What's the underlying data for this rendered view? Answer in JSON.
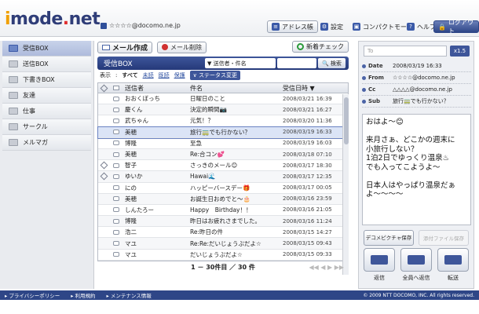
{
  "header": {
    "logo_main": "mode",
    "logo_i": "i",
    "logo_dot": ".",
    "logo_net": "net",
    "account": "☆☆☆☆@docomo.ne.jp",
    "buttons": [
      "アドレス帳",
      "設定",
      "コンパクトモード",
      "ヘルプ",
      "ログアウト"
    ]
  },
  "sidebar": {
    "items": [
      "受信BOX",
      "送信BOX",
      "下書きBOX",
      "友達",
      "仕事",
      "サークル",
      "メルマガ"
    ]
  },
  "toolbar": {
    "compose": "メール作成",
    "delete": "メール削除",
    "new_check": "新着チェック"
  },
  "box": {
    "title": "受信BOX",
    "search_select": "送信者・件名",
    "search_button": "検索"
  },
  "filter": {
    "label": "表示",
    "all": "すべて",
    "unread": "未読",
    "read": "既読",
    "protected": "保護",
    "status": "ステータス変更"
  },
  "table": {
    "headers": [
      "送信者",
      "件名",
      "受信日時 ▼"
    ],
    "rows": [
      {
        "sender": "おおくぼっち",
        "subject": "日曜日のこと",
        "date": "2008/03/21 16:39",
        "clip": false
      },
      {
        "sender": "慶くん",
        "subject": "決定的瞬間📷",
        "date": "2008/03/21 16:27",
        "clip": false
      },
      {
        "sender": "武ちゃん",
        "subject": "元気！？",
        "date": "2008/03/20 11:36",
        "clip": false
      },
      {
        "sender": "美穂",
        "subject": "旅行🚃でも行かない？",
        "date": "2008/03/19 16:33",
        "clip": false
      },
      {
        "sender": "博隆",
        "subject": "至急",
        "date": "2008/03/19 16:03",
        "clip": false
      },
      {
        "sender": "美穂",
        "subject": "Re:合コン💕",
        "date": "2008/03/18 07:10",
        "clip": false
      },
      {
        "sender": "智子",
        "subject": "さっきのメール😊",
        "date": "2008/03/17 18:30",
        "clip": true
      },
      {
        "sender": "ゆいか",
        "subject": "Hawai🌊",
        "date": "2008/03/17 12:35",
        "clip": true
      },
      {
        "sender": "にの",
        "subject": "ハッピーバースデー🎁",
        "date": "2008/03/17 00:05",
        "clip": false
      },
      {
        "sender": "美穂",
        "subject": "お誕生日おめでと〜🎂",
        "date": "2008/03/16 23:59",
        "clip": false
      },
      {
        "sender": "しんたろー",
        "subject": "Happy　Birthday！！",
        "date": "2008/03/16 21:05",
        "clip": false
      },
      {
        "sender": "博隆",
        "subject": "昨日はお疲れさまでした。",
        "date": "2008/03/16 11:24",
        "clip": false
      },
      {
        "sender": "浩二",
        "subject": "Re:昨日の件",
        "date": "2008/03/15 14:27",
        "clip": false
      },
      {
        "sender": "マユ",
        "subject": "Re:Re:だいじょうぶだよ☆",
        "date": "2008/03/15 09:43",
        "clip": false
      },
      {
        "sender": "マユ",
        "subject": "だいじょうぶだよ☆",
        "date": "2008/03/15 09:33",
        "clip": false
      }
    ]
  },
  "pager": {
    "text": "1 － 30件目 ／ 30 件",
    "nav": "◀◀ ◀ ▶ ▶▶"
  },
  "message": {
    "to_placeholder": "To",
    "zoom": "x1.5",
    "date_label": "Date",
    "date": "2008/03/19 16:33",
    "from_label": "From",
    "from": "☆☆☆☆@docomo.ne.jp",
    "cc_label": "Cc",
    "cc": "△△△△@docomo.ne.jp",
    "sub_label": "Sub",
    "sub": "旅行🚃でも行かない？",
    "body": "おはよ〜😊\n\n来月さぁ、どこかの週末に\n小旅行しない？\n1泊2日でゆっくり温泉♨\nでも入ってこようよ〜\n\n日本人はやっぱり温泉だぁ\nよ〜〜〜〜",
    "deco_save": "デコメピクチャ保存",
    "attach_save": "添付ファイル保存",
    "reply": "返信",
    "reply_all": "全員へ返信",
    "forward": "転送"
  },
  "footer": {
    "privacy": "▸ プライバシーポリシー",
    "terms": "▸ 利用規約",
    "maint": "▸ メンテナンス情報",
    "copyright": "© 2009 NTT DOCOMO, INC. All rights reserved."
  }
}
